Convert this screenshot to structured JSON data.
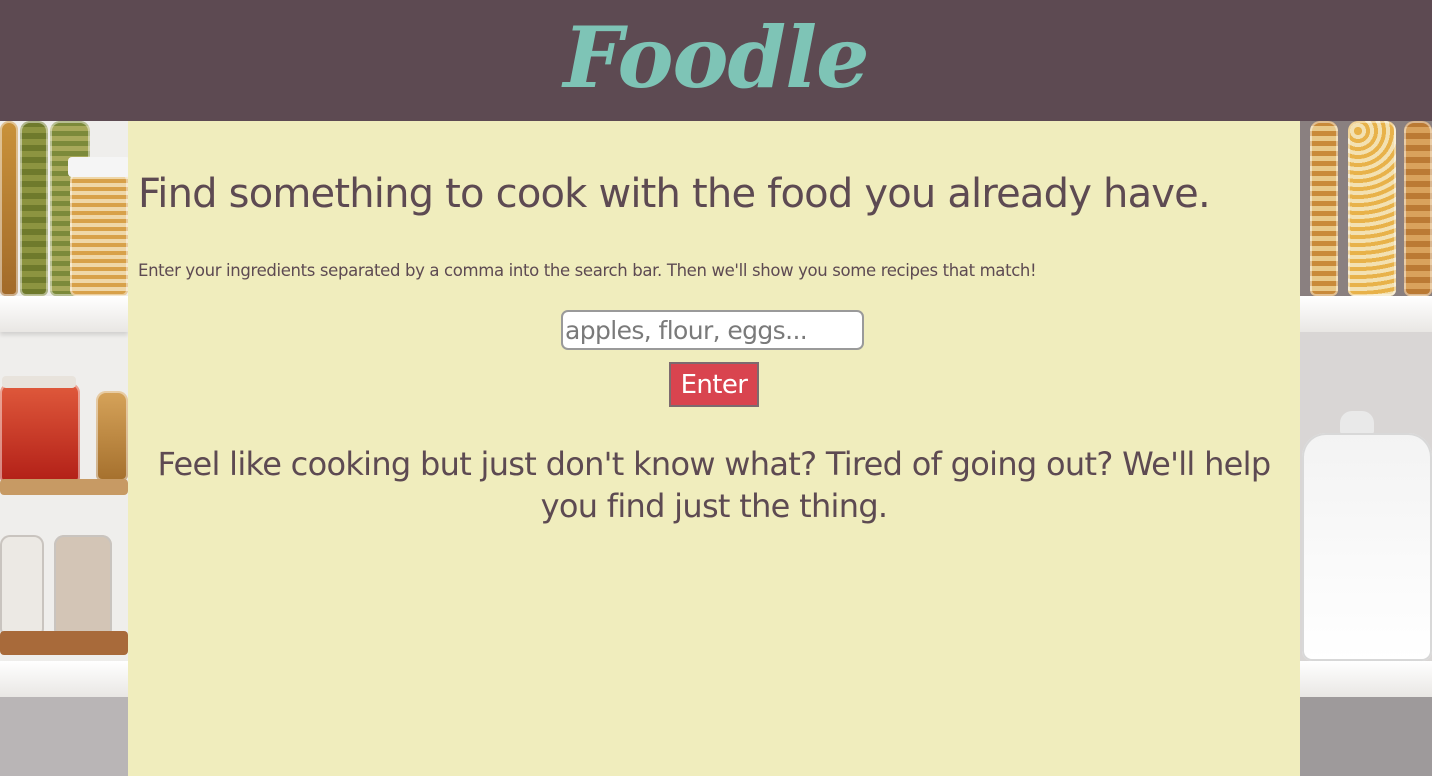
{
  "header": {
    "logo_text": "Foodle"
  },
  "main": {
    "headline": "Find something to cook with the food you already have.",
    "instructions": "Enter your ingredients separated by a comma into the search bar. Then we'll show you some recipes that match!",
    "search": {
      "placeholder": "apples, flour, eggs...",
      "value": ""
    },
    "enter_button_label": "Enter",
    "tagline": "Feel like cooking but just don't know what? Tired of going out? We'll help you find just the thing."
  },
  "colors": {
    "header_bg": "#5d4a52",
    "logo": "#7ec4b6",
    "panel_bg": "#f0edbd",
    "text": "#5d4a52",
    "button_bg": "#d9444f"
  }
}
